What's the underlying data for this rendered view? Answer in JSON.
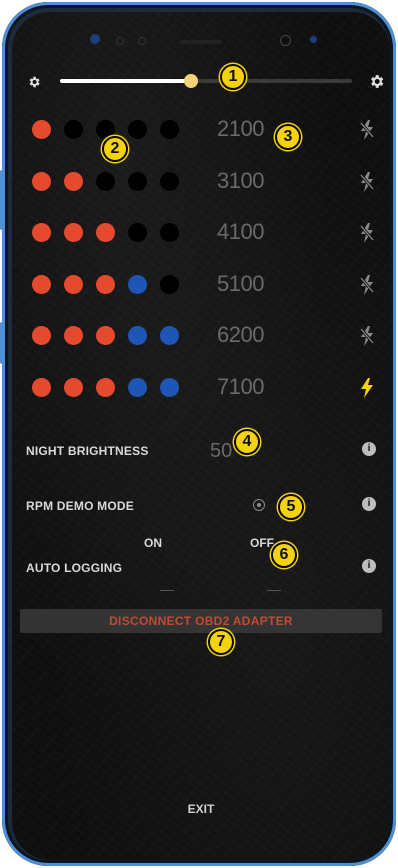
{
  "colors": {
    "dot_red": "#e64a2e",
    "dot_blue": "#1e56b5",
    "dot_off": "#000000",
    "flash_off": "#8a8a8a",
    "flash_on": "#f4d20d",
    "disconnect_text": "#c34a33",
    "badge": "#f4d20d"
  },
  "brightness_slider": {
    "value_percent": 45
  },
  "shift_rows": [
    {
      "rpm": "2100",
      "dots": [
        "red",
        "off",
        "off",
        "off",
        "off"
      ],
      "flash": "off"
    },
    {
      "rpm": "3100",
      "dots": [
        "red",
        "red",
        "off",
        "off",
        "off"
      ],
      "flash": "off"
    },
    {
      "rpm": "4100",
      "dots": [
        "red",
        "red",
        "red",
        "off",
        "off"
      ],
      "flash": "off"
    },
    {
      "rpm": "5100",
      "dots": [
        "red",
        "red",
        "red",
        "blue",
        "off"
      ],
      "flash": "off"
    },
    {
      "rpm": "6200",
      "dots": [
        "red",
        "red",
        "red",
        "blue",
        "blue"
      ],
      "flash": "off"
    },
    {
      "rpm": "7100",
      "dots": [
        "red",
        "red",
        "red",
        "blue",
        "blue"
      ],
      "flash": "on"
    }
  ],
  "settings": {
    "night_brightness": {
      "label": "NIGHT BRIGHTNESS",
      "value": "50"
    },
    "rpm_demo_mode": {
      "label": "RPM DEMO MODE"
    },
    "auto_logging": {
      "label": "AUTO LOGGING",
      "on_label": "ON",
      "off_label": "OFF"
    }
  },
  "disconnect_label": "DISCONNECT OBD2 ADAPTER",
  "exit_label": "EXIT",
  "badges": [
    "1",
    "2",
    "3",
    "4",
    "5",
    "6",
    "7"
  ],
  "icons": {
    "left": "settings-small-icon",
    "right": "settings-icon",
    "info": "info-icon",
    "flash": "flash-icon",
    "flash_off": "flash-off-icon"
  }
}
